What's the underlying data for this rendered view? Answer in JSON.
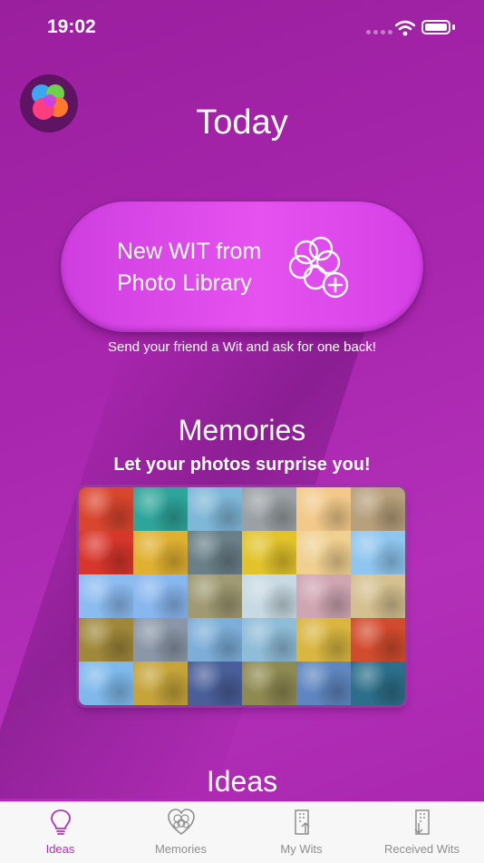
{
  "status_bar": {
    "time": "19:02"
  },
  "header": {
    "title": "Today"
  },
  "new_wit": {
    "line1": "New WIT from",
    "line2": "Photo Library",
    "caption": "Send your friend a Wit and ask for one back!"
  },
  "memories": {
    "title": "Memories",
    "subtitle": "Let your photos surprise you!",
    "tiles": [
      "#d9452e",
      "#2ea59a",
      "#7fb7d8",
      "#9aa0a4",
      "#f2c98a",
      "#b7a07c",
      "#d7362b",
      "#e0b030",
      "#6a7f88",
      "#e2c32a",
      "#f0d090",
      "#8fc6ef",
      "#8bbbf0",
      "#88b6ef",
      "#9f9a72",
      "#c7d9e2",
      "#cfa5b2",
      "#d4c090",
      "#a0883a",
      "#8b97a8",
      "#7daed9",
      "#8fbcd8",
      "#d9b640",
      "#d24b2e",
      "#7fb9ec",
      "#c6a43a",
      "#4a5f9a",
      "#8f8a52",
      "#5f86c0",
      "#2d6f8a"
    ]
  },
  "ideas": {
    "title": "Ideas"
  },
  "tabs": [
    {
      "label": "Ideas",
      "icon": "lightbulb-icon",
      "active": true
    },
    {
      "label": "Memories",
      "icon": "heart-flower-icon",
      "active": false
    },
    {
      "label": "My Wits",
      "icon": "building-up-icon",
      "active": false
    },
    {
      "label": "Received Wits",
      "icon": "building-down-icon",
      "active": false
    }
  ],
  "colors": {
    "accent": "#b52fbd",
    "background": "#a826ae",
    "button": "#e24ff0"
  }
}
